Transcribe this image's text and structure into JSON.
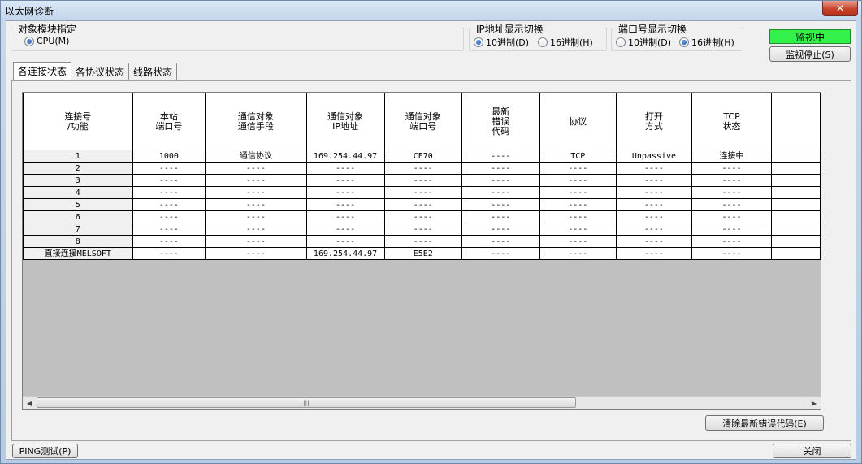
{
  "window": {
    "title": "以太网诊断",
    "close_glyph": "✕"
  },
  "target_module": {
    "title": "对象模块指定",
    "option": "CPU(M)"
  },
  "ip_display": {
    "title": "IP地址显示切换",
    "options": [
      "10进制(D)",
      "16进制(H)"
    ],
    "selected": 0
  },
  "port_display": {
    "title": "端口号显示切换",
    "options": [
      "10进制(D)",
      "16进制(H)"
    ],
    "selected": 1
  },
  "monitor": {
    "status": "监视中",
    "stop_label": "监视停止(S)",
    "status_color": "#33f04a"
  },
  "tabs": [
    "各连接状态",
    "各协议状态",
    "线路状态"
  ],
  "grid": {
    "headers": [
      "连接号\n/功能",
      "本站\n端口号",
      "通信对象\n通信手段",
      "通信对象\nIP地址",
      "通信对象\n端口号",
      "最新\n错误\n代码",
      "协议",
      "打开\n方式",
      "TCP\n状态",
      ""
    ],
    "rows": [
      [
        "1",
        "1000",
        "通信协议",
        "169.254.44.97",
        "CE70",
        "----",
        "TCP",
        "Unpassive",
        "连接中",
        ""
      ],
      [
        "2",
        "----",
        "----",
        "----",
        "----",
        "----",
        "----",
        "----",
        "----",
        ""
      ],
      [
        "3",
        "----",
        "----",
        "----",
        "----",
        "----",
        "----",
        "----",
        "----",
        ""
      ],
      [
        "4",
        "----",
        "----",
        "----",
        "----",
        "----",
        "----",
        "----",
        "----",
        ""
      ],
      [
        "5",
        "----",
        "----",
        "----",
        "----",
        "----",
        "----",
        "----",
        "----",
        ""
      ],
      [
        "6",
        "----",
        "----",
        "----",
        "----",
        "----",
        "----",
        "----",
        "----",
        ""
      ],
      [
        "7",
        "----",
        "----",
        "----",
        "----",
        "----",
        "----",
        "----",
        "----",
        ""
      ],
      [
        "8",
        "----",
        "----",
        "----",
        "----",
        "----",
        "----",
        "----",
        "----",
        ""
      ],
      [
        "直接连接MELSOFT",
        "----",
        "----",
        "169.254.44.97",
        "E5E2",
        "----",
        "----",
        "----",
        "----",
        ""
      ]
    ],
    "scroll_left": "◀",
    "scroll_right": "▶",
    "scroll_grip": "|||"
  },
  "buttons": {
    "clear_error": "清除最新错误代码(E)",
    "ping": "PING测试(P)",
    "close": "关闭"
  }
}
